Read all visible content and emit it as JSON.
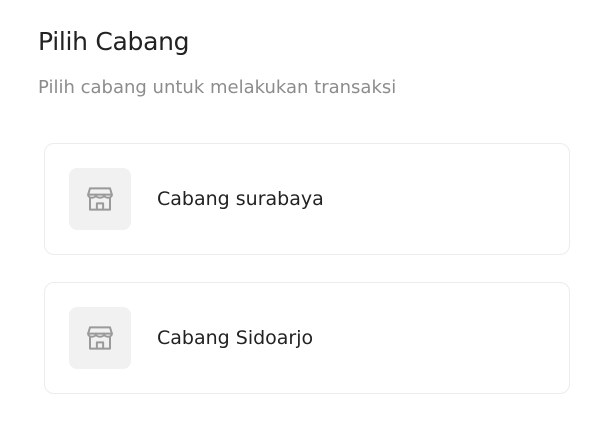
{
  "header": {
    "title": "Pilih Cabang",
    "subtitle": "Pilih cabang untuk melakukan transaksi"
  },
  "branches": [
    {
      "label": "Cabang surabaya",
      "icon": "store-icon"
    },
    {
      "label": "Cabang Sidoarjo",
      "icon": "store-icon"
    }
  ],
  "colors": {
    "title": "#222222",
    "subtitle": "#8c8c8c",
    "card_border": "#ececec",
    "icon_bg": "#f1f1f1",
    "icon_stroke": "#9a9a9a"
  }
}
